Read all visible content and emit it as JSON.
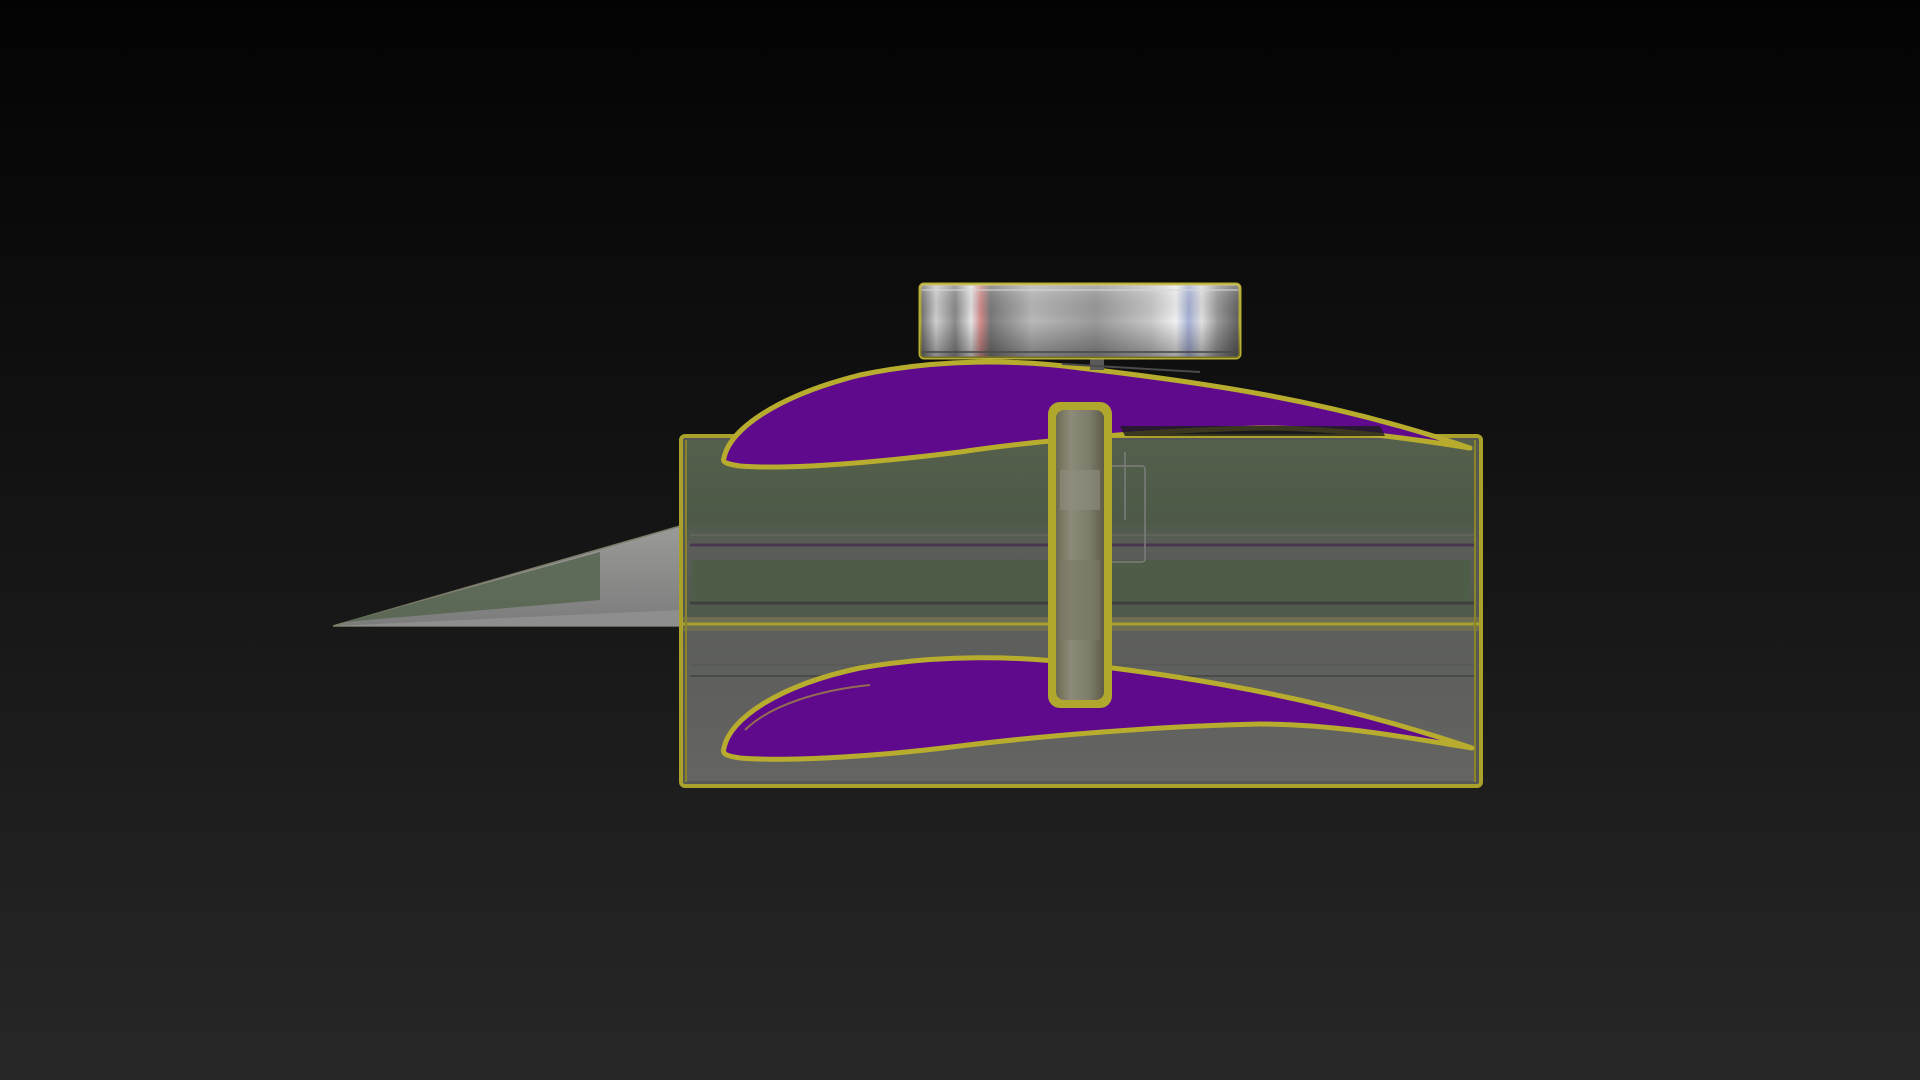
{
  "scene": {
    "background": {
      "top": "#030303",
      "bottom": "#272727"
    },
    "colors": {
      "airfoil_fill": "#5f0a8c",
      "airfoil_edge": "#b8ad2c",
      "frame_edge": "#aaa22a",
      "glass_green": "#4f5c48",
      "glass_gray": "#5b5e5a",
      "blade_green": "#55654c",
      "blade_gray": "#8a8c8a",
      "cap_metal": "#9c9c9c"
    }
  }
}
